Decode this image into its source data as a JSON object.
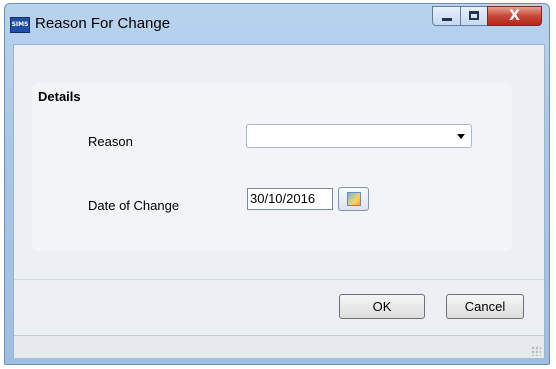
{
  "window": {
    "title": "Reason For Change",
    "app_icon_text": "SIMS"
  },
  "titlebar_controls": {
    "close_glyph": "X"
  },
  "details": {
    "group_title": "Details",
    "reason_label": "Reason",
    "reason_value": "",
    "date_label": "Date of Change",
    "date_value": "30/10/2016"
  },
  "buttons": {
    "ok_label": "OK",
    "cancel_label": "Cancel"
  },
  "colors": {
    "title_bar": "#a9c6e6",
    "close_button": "#c8473a",
    "client_background": "#eceff4"
  }
}
